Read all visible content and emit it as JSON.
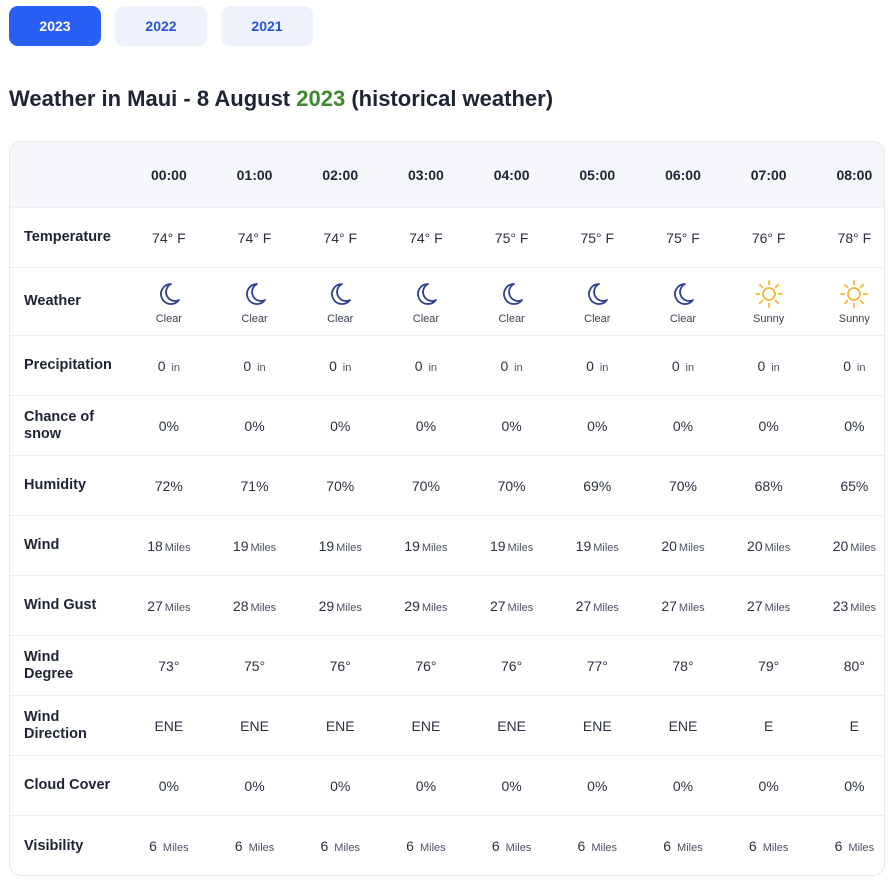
{
  "years": [
    {
      "label": "2023",
      "active": true
    },
    {
      "label": "2022",
      "active": false
    },
    {
      "label": "2021",
      "active": false
    }
  ],
  "title": {
    "prefix": "Weather in Maui - 8 August ",
    "year": "2023",
    "suffix": " (historical weather)"
  },
  "colors": {
    "accent": "#2a5ff5",
    "year_accent": "#3e8a2c",
    "moon_icon": "#2f3f8f",
    "sun_icon": "#f2b738"
  },
  "hours": [
    "00:00",
    "01:00",
    "02:00",
    "03:00",
    "04:00",
    "05:00",
    "06:00",
    "07:00",
    "08:00"
  ],
  "rows": {
    "temperature": {
      "label": "Temperature",
      "values": [
        "74° F",
        "74° F",
        "74° F",
        "74° F",
        "75° F",
        "75° F",
        "75° F",
        "76° F",
        "78° F"
      ]
    },
    "weather": {
      "label": "Weather",
      "icons": [
        "moon-icon",
        "moon-icon",
        "moon-icon",
        "moon-icon",
        "moon-icon",
        "moon-icon",
        "moon-icon",
        "sun-icon",
        "sun-icon"
      ],
      "captions": [
        "Clear",
        "Clear",
        "Clear",
        "Clear",
        "Clear",
        "Clear",
        "Clear",
        "Sunny",
        "Sunny"
      ]
    },
    "precipitation": {
      "label": "Precipitation",
      "values": [
        "0",
        "0",
        "0",
        "0",
        "0",
        "0",
        "0",
        "0",
        "0"
      ],
      "unit": "in"
    },
    "snow": {
      "label_line1": "Chance of",
      "label_line2": "snow",
      "values": [
        "0%",
        "0%",
        "0%",
        "0%",
        "0%",
        "0%",
        "0%",
        "0%",
        "0%"
      ]
    },
    "humidity": {
      "label": "Humidity",
      "values": [
        "72%",
        "71%",
        "70%",
        "70%",
        "70%",
        "69%",
        "70%",
        "68%",
        "65%"
      ]
    },
    "wind": {
      "label": "Wind",
      "values": [
        "18",
        "19",
        "19",
        "19",
        "19",
        "19",
        "20",
        "20",
        "20"
      ],
      "unit": "Miles"
    },
    "wind_gust": {
      "label": "Wind Gust",
      "values": [
        "27",
        "28",
        "29",
        "29",
        "27",
        "27",
        "27",
        "27",
        "23"
      ],
      "unit": "Miles"
    },
    "wind_degree": {
      "label_line1": "Wind",
      "label_line2": "Degree",
      "values": [
        "73°",
        "75°",
        "76°",
        "76°",
        "76°",
        "77°",
        "78°",
        "79°",
        "80°"
      ]
    },
    "wind_direction": {
      "label_line1": "Wind",
      "label_line2": "Direction",
      "values": [
        "ENE",
        "ENE",
        "ENE",
        "ENE",
        "ENE",
        "ENE",
        "ENE",
        "E",
        "E"
      ]
    },
    "cloud_cover": {
      "label": "Cloud Cover",
      "values": [
        "0%",
        "0%",
        "0%",
        "0%",
        "0%",
        "0%",
        "0%",
        "0%",
        "0%"
      ]
    },
    "visibility": {
      "label": "Visibility",
      "values": [
        "6",
        "6",
        "6",
        "6",
        "6",
        "6",
        "6",
        "6",
        "6"
      ],
      "unit": "Miles"
    }
  }
}
